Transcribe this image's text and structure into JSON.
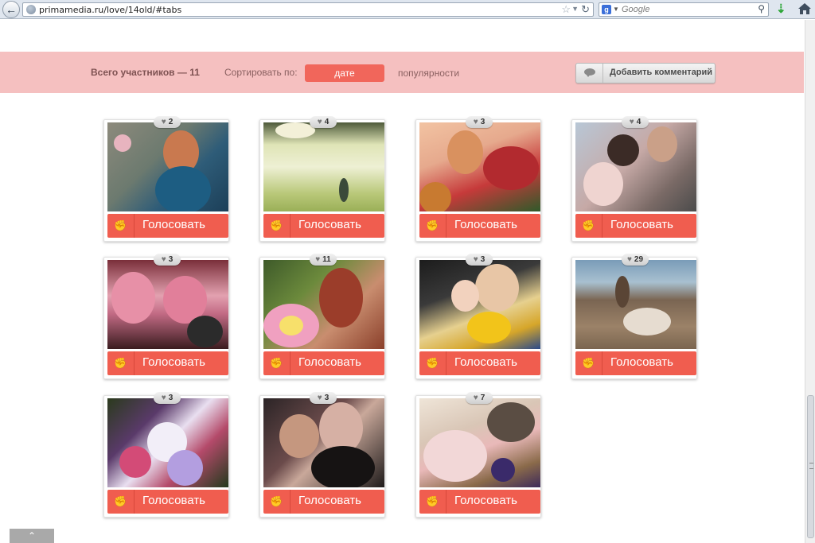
{
  "browser": {
    "url": "primamedia.ru/love/14old/#tabs",
    "search_placeholder": "Google",
    "search_engine_letter": "g"
  },
  "header": {
    "total": "Всего участников — 11",
    "sort_label": "Сортировать по:",
    "sort_date": "дате",
    "sort_popularity": "популярности",
    "add_comment": "Добавить комментарий"
  },
  "vote_label": "Голосовать",
  "cards": [
    {
      "votes": "2",
      "scene": "woman-blue-dress-roses"
    },
    {
      "votes": "4",
      "scene": "person-field-sun"
    },
    {
      "votes": "3",
      "scene": "woman-roses-dog"
    },
    {
      "votes": "4",
      "scene": "family-child"
    },
    {
      "votes": "3",
      "scene": "pink-balloons-car"
    },
    {
      "votes": "11",
      "scene": "woman-flowers-forest"
    },
    {
      "votes": "3",
      "scene": "mother-child-tulips"
    },
    {
      "votes": "29",
      "scene": "beach-heart-stones"
    },
    {
      "votes": "3",
      "scene": "bouquet-hyacinths"
    },
    {
      "votes": "3",
      "scene": "two-girls-selfie"
    },
    {
      "votes": "7",
      "scene": "rose-box-gift"
    }
  ],
  "colors": {
    "accent": "#f05d4f",
    "bar": "#f5c0c0",
    "sort_active": "#f1665b"
  }
}
